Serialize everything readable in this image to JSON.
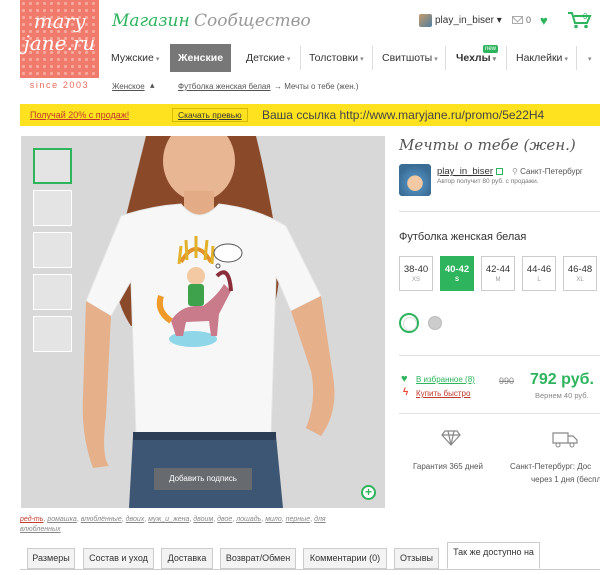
{
  "logo": {
    "text_line1": "mary",
    "text_line2": "jane.ru",
    "since": "since 2003"
  },
  "nav": {
    "shop": "Магазин",
    "community": "Сообщество"
  },
  "user": {
    "name": "play_in_biser ▾",
    "mail_count": "0",
    "cart_count": "0"
  },
  "menu": {
    "items": [
      {
        "label": "Мужские"
      },
      {
        "label": "Женские"
      },
      {
        "label": "Детские"
      },
      {
        "label": "Толстовки"
      },
      {
        "label": "Свитшоты"
      },
      {
        "label": "Чехлы"
      },
      {
        "label": "Наклейки"
      }
    ],
    "new_badge": "new"
  },
  "breadcrumb": {
    "item1": "Женское",
    "item2": "Футболка женская белая",
    "item3": "→ Мечты о тебе (жен.)"
  },
  "promo": {
    "get": "Получай 20% с продаж!",
    "button": "Скачать превью",
    "link": "Ваша ссылка http://www.maryjane.ru/promo/5e22H4"
  },
  "product": {
    "caption_button": "Добавить подпись",
    "title": "Мечты о тебе (жен.)",
    "designer": "play_in_biser",
    "city": "Санкт-Петербург",
    "author_note": "Автор получит 80 руб. с продажи.",
    "type": "Футболка женская белая",
    "sizes": [
      {
        "size": "38-40",
        "label": "XS"
      },
      {
        "size": "40-42",
        "label": "S"
      },
      {
        "size": "42-44",
        "label": "M"
      },
      {
        "size": "44-46",
        "label": "L"
      },
      {
        "size": "46-48",
        "label": "XL"
      }
    ],
    "selected_size": "40-42",
    "favorites": "В избранное (8)",
    "buy_fast": "Купить быстро",
    "old_price": "990",
    "price": "792 руб.",
    "cashback": "Вернем 40 руб.",
    "guarantee": "Гарантия 365 дней",
    "delivery_line1": "Санкт-Петербург: Дос",
    "delivery_line2": "через 1 дня (беспл"
  },
  "tags": {
    "line1": [
      "ред-ть",
      "ромашка",
      "влюблённые",
      "двоих",
      "муж_и_жена",
      "двоим",
      "двое",
      "лошадь",
      "мило",
      "перные",
      "для"
    ],
    "line2": "влюбленных"
  },
  "tabs": [
    {
      "label": "Размеры"
    },
    {
      "label": "Состав и уход"
    },
    {
      "label": "Доставка"
    },
    {
      "label": "Возврат/Обмен"
    },
    {
      "label": "Комментарии (0)"
    },
    {
      "label": "Отзывы"
    },
    {
      "label": "Так же доступно на"
    }
  ],
  "colors": {
    "brand_green": "#2db45c",
    "logo_coral": "#f07b6c",
    "promo_yellow": "#ffe21f",
    "alert_red": "#c0392b"
  }
}
